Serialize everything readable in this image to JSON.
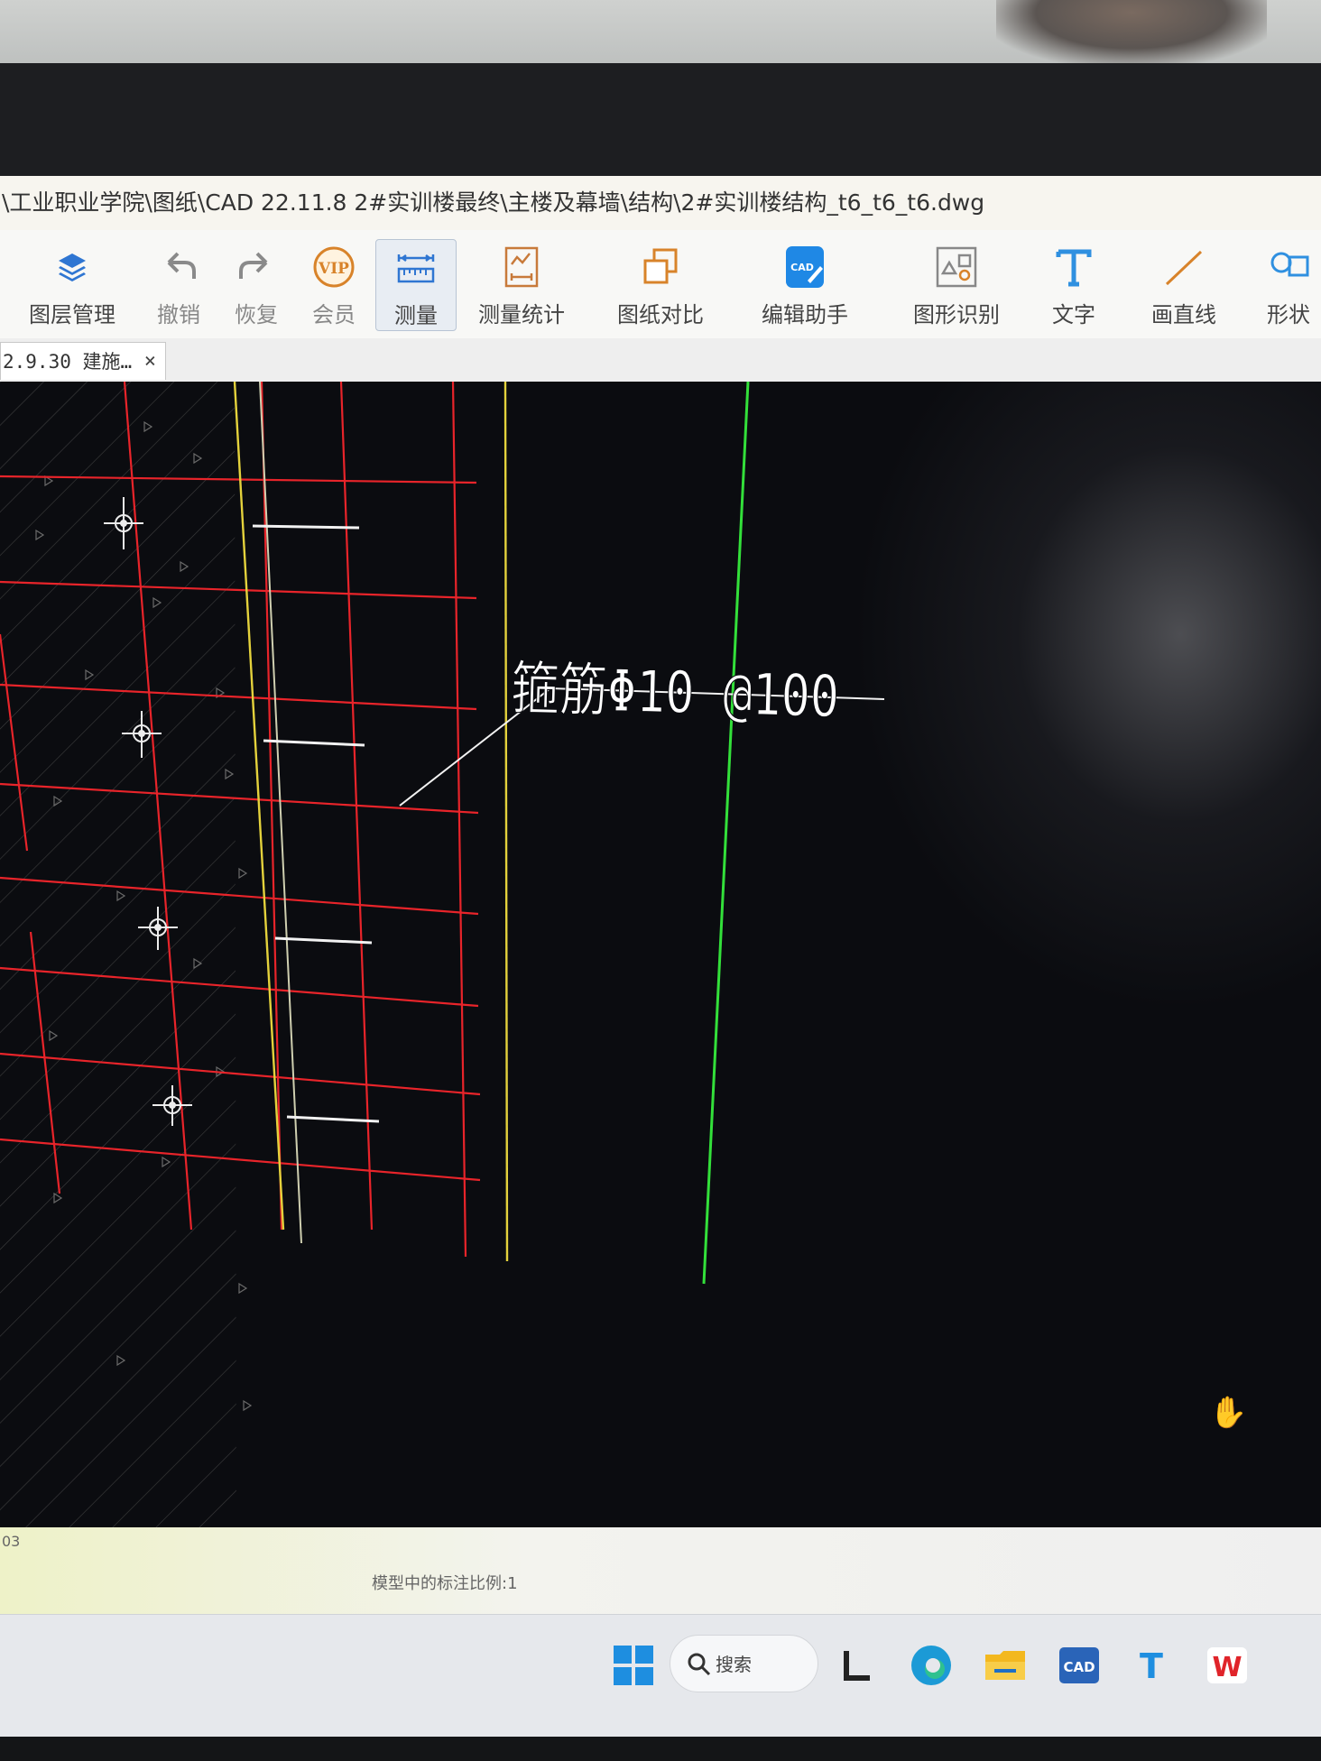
{
  "title_bar": {
    "path": "\\工业职业学院\\图纸\\CAD  22.11.8 2#实训楼最终\\主楼及幕墙\\结构\\2#实训楼结构_t6_t6_t6.dwg"
  },
  "toolbar": {
    "items": [
      {
        "label": "图层管理",
        "icon": "layers-icon"
      },
      {
        "label": "撤销",
        "icon": "undo-icon"
      },
      {
        "label": "恢复",
        "icon": "redo-icon"
      },
      {
        "label": "会员",
        "icon": "vip-icon",
        "badge": "VIP"
      },
      {
        "label": "测量",
        "icon": "measure-icon"
      },
      {
        "label": "测量统计",
        "icon": "measure-stats-icon"
      },
      {
        "label": "图纸对比",
        "icon": "compare-icon"
      },
      {
        "label": "编辑助手",
        "icon": "edit-assistant-icon",
        "badge": "CAD"
      },
      {
        "label": "图形识别",
        "icon": "shape-recognition-icon"
      },
      {
        "label": "文字",
        "icon": "text-icon"
      },
      {
        "label": "画直线",
        "icon": "line-icon"
      },
      {
        "label": "形状",
        "icon": "shape-icon"
      }
    ],
    "active": "测量"
  },
  "tabs": [
    {
      "label": "2.9.30 建施…",
      "close": "×"
    }
  ],
  "drawing": {
    "annotation": "箍筋Φ10 @100",
    "background": "#0b0c10",
    "colors": {
      "grid": "#e8242a",
      "yellow": "#e4d23c",
      "green": "#33e03a",
      "white": "#f2f2f2"
    }
  },
  "status_bar": {
    "left_text": "03",
    "scale_text": "模型中的标注比例:1"
  },
  "taskbar": {
    "search_label": "搜索",
    "apps": [
      "windows-start-icon",
      "task-view-icon",
      "edge-icon",
      "file-explorer-icon",
      "cad-app-icon",
      "text-app-icon",
      "wps-icon"
    ],
    "cad_badge": "CAD",
    "text_badge": "T",
    "wps_badge": "W"
  }
}
